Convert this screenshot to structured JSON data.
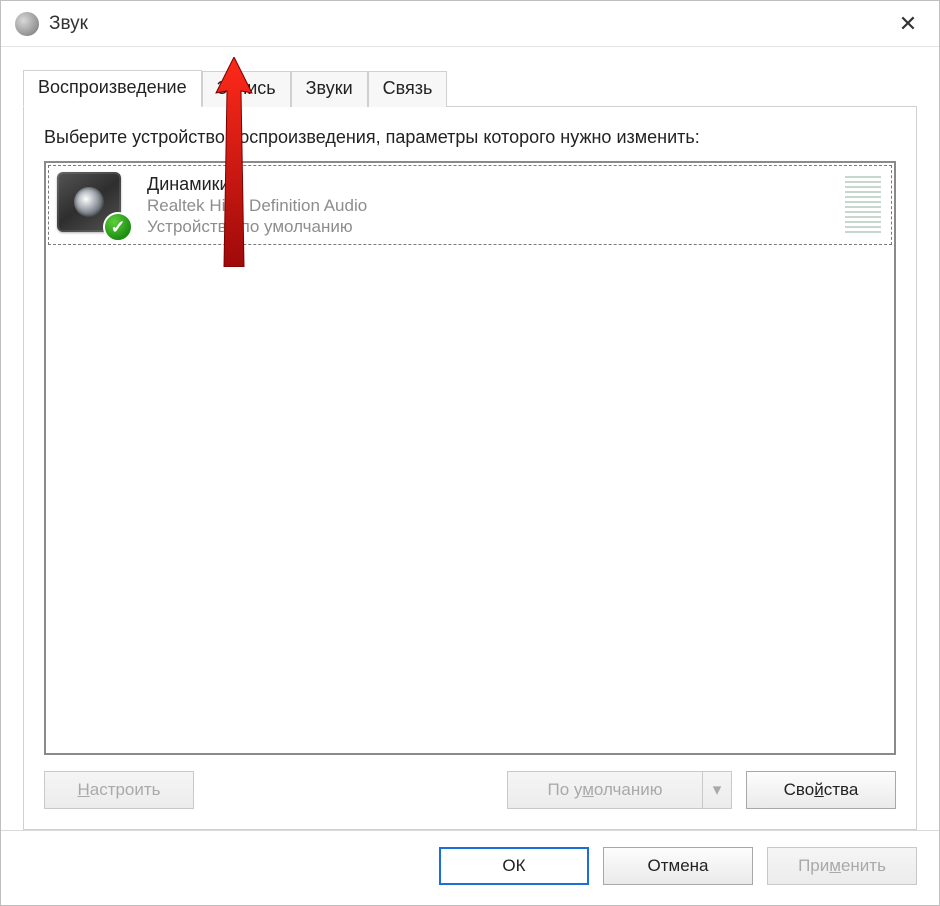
{
  "window": {
    "title": "Звук",
    "close_glyph": "✕"
  },
  "tabs": {
    "playback": "Воспроизведение",
    "recording": "Запись",
    "sounds": "Звуки",
    "communications": "Связь"
  },
  "panel": {
    "instruction": "Выберите устройство воспроизведения, параметры которого нужно изменить:",
    "device": {
      "name": "Динамики",
      "driver": "Realtek High Definition Audio",
      "status": "Устройство по умолчанию",
      "check_glyph": "✓"
    },
    "buttons": {
      "configure_prefix": "Н",
      "configure_rest": "астроить",
      "set_default_prefix": "По у",
      "set_default_mid": "м",
      "set_default_rest": "олчанию",
      "dropdown_glyph": "▾",
      "properties_prefix": "Сво",
      "properties_mid": "й",
      "properties_rest": "ства"
    }
  },
  "footer": {
    "ok": "ОК",
    "cancel": "Отмена",
    "apply_prefix": "При",
    "apply_mid": "м",
    "apply_rest": "енить"
  }
}
